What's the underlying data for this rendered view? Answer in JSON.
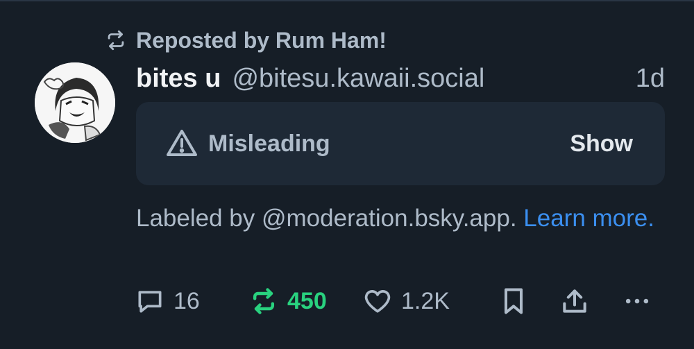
{
  "repost_banner": {
    "text": "Reposted by Rum Ham!"
  },
  "post": {
    "display_name": "bites u",
    "handle": "@bitesu.kawaii.social",
    "time": "1d"
  },
  "content_label": {
    "label": "Misleading",
    "action": "Show"
  },
  "moderation_note": {
    "text": "Labeled by @moderation.bsky.app. ",
    "link": "Learn more."
  },
  "actions": {
    "reply_count": "16",
    "repost_count": "450",
    "like_count": "1.2K"
  },
  "colors": {
    "background": "#161e27",
    "muted_text": "#aebbc9",
    "link": "#3b8ff0",
    "repost_active": "#29d27f"
  }
}
